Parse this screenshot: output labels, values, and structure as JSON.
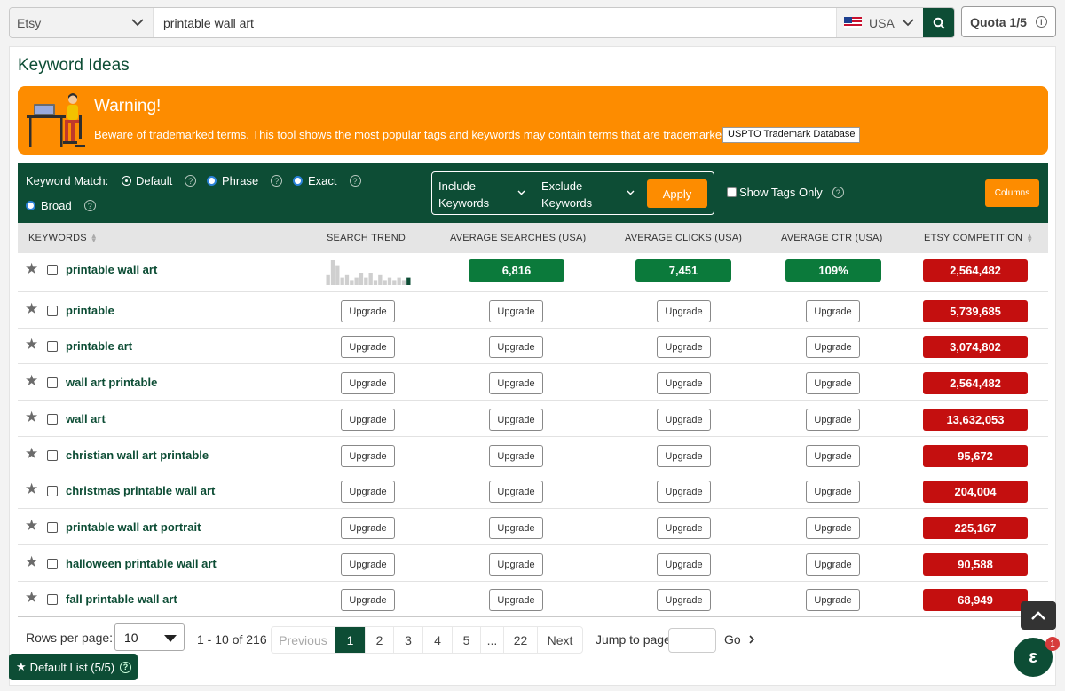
{
  "search": {
    "platform": "Etsy",
    "query": "printable wall art",
    "country": "USA",
    "quota_label": "Quota 1/5"
  },
  "page": {
    "title": "Keyword Ideas"
  },
  "warning": {
    "title": "Warning!",
    "text": "Beware of trademarked terms. This tool shows the most popular tags and keywords may contain terms that are trademarked.",
    "link_label": "USPTO Trademark Database"
  },
  "filters": {
    "match_label": "Keyword Match:",
    "options": [
      "Default",
      "Phrase",
      "Exact",
      "Broad"
    ],
    "selected": "Default",
    "include_label_1": "Include",
    "include_label_2": "Keywords",
    "exclude_label_1": "Exclude",
    "exclude_label_2": "Keywords",
    "apply_label": "Apply",
    "tags_only_label": "Show Tags Only",
    "columns_label": "Columns"
  },
  "table": {
    "headers": [
      "KEYWORDS",
      "SEARCH TREND",
      "AVERAGE SEARCHES (USA)",
      "AVERAGE CLICKS (USA)",
      "AVERAGE CTR (USA)",
      "ETSY COMPETITION"
    ],
    "first_row": {
      "keyword": "printable wall art",
      "searches": "6,816",
      "clicks": "7,451",
      "ctr": "109%",
      "competition": "2,564,482"
    },
    "trend_values": [
      4,
      10,
      8,
      3,
      4,
      2,
      3,
      5,
      3,
      5,
      2,
      4,
      2,
      3,
      2,
      3,
      2,
      3
    ],
    "upgrade_label": "Upgrade",
    "rows": [
      {
        "keyword": "printable",
        "competition": "5,739,685"
      },
      {
        "keyword": "printable art",
        "competition": "3,074,802"
      },
      {
        "keyword": "wall art printable",
        "competition": "2,564,482"
      },
      {
        "keyword": "wall art",
        "competition": "13,632,053"
      },
      {
        "keyword": "christian wall art printable",
        "competition": "95,672"
      },
      {
        "keyword": "christmas printable wall art",
        "competition": "204,004"
      },
      {
        "keyword": "printable wall art portrait",
        "competition": "225,167"
      },
      {
        "keyword": "halloween printable wall art",
        "competition": "90,588"
      },
      {
        "keyword": "fall printable wall art",
        "competition": "68,949"
      }
    ]
  },
  "pagination": {
    "rows_per_page_label": "Rows per page:",
    "rows_per_page": "10",
    "range": "1 - 10 of 216",
    "previous": "Previous",
    "pages": [
      "1",
      "2",
      "3",
      "4",
      "5",
      "...",
      "22"
    ],
    "current_page": "1",
    "next": "Next",
    "jump_label": "Jump to page",
    "go_label": "Go"
  },
  "default_list": {
    "label": "Default List (5/5)"
  },
  "chat": {
    "badge": "1",
    "icon": "ε"
  },
  "colors": {
    "brand_green": "#0d4d35",
    "accent_orange": "#fd8c00",
    "metric_green": "#0b7a3b",
    "competition_red": "#c40f0f"
  }
}
